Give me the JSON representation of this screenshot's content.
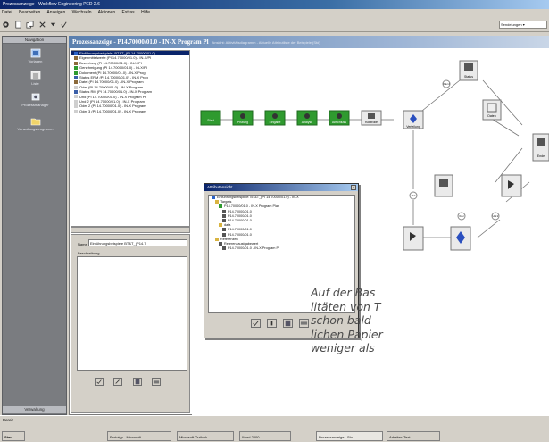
{
  "titlebar": {
    "title": "Prozessanzeige - Workflow-Engineering PED 2.6"
  },
  "menubar": {
    "items": [
      "Datei",
      "Bearbeiten",
      "Anzeigen",
      "Wechseln",
      "Aktionen",
      "Extras",
      "Hilfe"
    ]
  },
  "toolbar": {
    "search_value": "Sendelungen ▾"
  },
  "left_panel": {
    "header": "Navigation",
    "items": [
      "Vorlagen",
      "Liste",
      "Prozessmanager",
      "Verwaltungsprogramm"
    ],
    "footer": "Verwaltung"
  },
  "main": {
    "title": "Prozessanzeige - P14.70000/01.0 - IN-X Program Pl",
    "subtitle": "Ansicht: Aktivitätsdiagramm - Aktuelle Attributliste der Beispiele (Std)"
  },
  "tree_rows": [
    "Einführungsbeispiele: BT&T_(PI 14.70000/01.0)",
    "Eigenmittelwerte (PI 14.70000/01.0) - IN-X/PI",
    "Bewertung (PI 14.70000/01.0) - IN-X/PI",
    "Genehmigung (PI 14.70000/01.0) - IN-X/PI",
    "Dokument (PI 14.70000/01.0) - IN-X Prog",
    "Status ERM (PI 14.70000/01.0) - IN-X Prog",
    "Datei (PI 14.70000/01.0) - IN-X Program",
    "Oder (PI 14.70000/01.0) - IN-X Program",
    "Status RM (PI 14.70000/01.0) - IN-X Program",
    "Und (PI 14.70000/01.0) - IN-X Program Pl",
    "Und 2 (PI 14.70000/01.0) - IN-X Program",
    "Oder 2 (PI 14.70000/01.0) - IN-X Program",
    "Oder 3 (PI 14.70000/01.0) - IN-X Program"
  ],
  "properties": {
    "name_label": "Name",
    "name_value": "Einführungsbeispiele BT&T_(P14.7",
    "desc_label": "Beschreibung"
  },
  "workflow": {
    "node_labels": [
      "Start",
      "Prüfung",
      "Eingabe",
      "Analyse",
      "Abschluss",
      "Kontrolle",
      "Verteilung",
      "Status",
      "Daten",
      "Ende"
    ],
    "gate_labels": [
      "Und",
      "Oder",
      "Und 2",
      "Oder 2"
    ]
  },
  "dialog": {
    "title": "Attributansicht",
    "rows": [
      "Einführungsbeispiele: BT&T_(PI 14.70000/01.0) - IN-X",
      "Targets",
      "P14.70000/01.0 - IN-X Program Plan",
      "P14.70000/01.0",
      "P14.70000/01.0",
      "P14.70000/01.0",
      "data",
      "P14.70000/01.0",
      "P14.70000/01.0",
      "Referenzen",
      "Referenzaustgabewert",
      "P14.70000/01.0 - IN-X Program Pl"
    ]
  },
  "statusbar": {
    "text": "Bereit"
  },
  "taskbar": {
    "start": "Start",
    "tasks": [
      "Prototyp - Microsoft...",
      "Microsoft Outlook",
      "Word 2000",
      "Prozessanzeige - Stu...",
      "Arbeiter: Text"
    ]
  },
  "caption": {
    "line1": "Auf der Bas",
    "line2": "litäten von T",
    "line3": "schon bald",
    "line4": "lichen Papier",
    "line5": "weniger als"
  },
  "colors": {
    "node_green": "#2f9a2f",
    "title_blue": "#0a246a",
    "workflow_bg": "#ffffff"
  }
}
